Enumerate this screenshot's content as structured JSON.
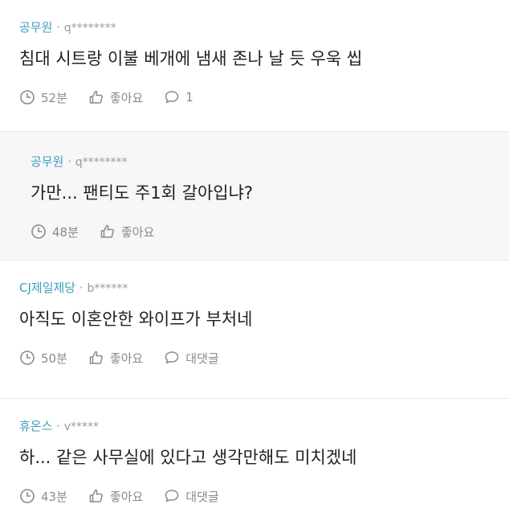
{
  "comments": [
    {
      "company": "공무원",
      "user": "q********",
      "text": "침대 시트랑 이불 베개에 냄새 존나 날 듯 우욱 씹",
      "time": "52분",
      "like_label": "좋아요",
      "reply_label": "1"
    },
    {
      "company": "공무원",
      "user": "q********",
      "text": "가만... 팬티도 주1회 갈아입냐?",
      "time": "48분",
      "like_label": "좋아요"
    },
    {
      "company": "CJ제일제당",
      "user": "b******",
      "text": "아직도 이혼안한 와이프가 부처네",
      "time": "50분",
      "like_label": "좋아요",
      "reply_label": "대댓글"
    },
    {
      "company": "휴온스",
      "user": "v*****",
      "text": "하... 같은 사무실에 있다고 생각만해도 미치겠네",
      "time": "43분",
      "like_label": "좋아요",
      "reply_label": "대댓글"
    }
  ],
  "meta_separator": "·",
  "colors": {
    "company": "#3f9fbd",
    "muted": "#8a8a8a",
    "reply_bg": "#f7f7f8"
  },
  "icons": {
    "time": "clock-icon",
    "like": "thumbs-up-icon",
    "reply": "speech-bubble-icon"
  }
}
